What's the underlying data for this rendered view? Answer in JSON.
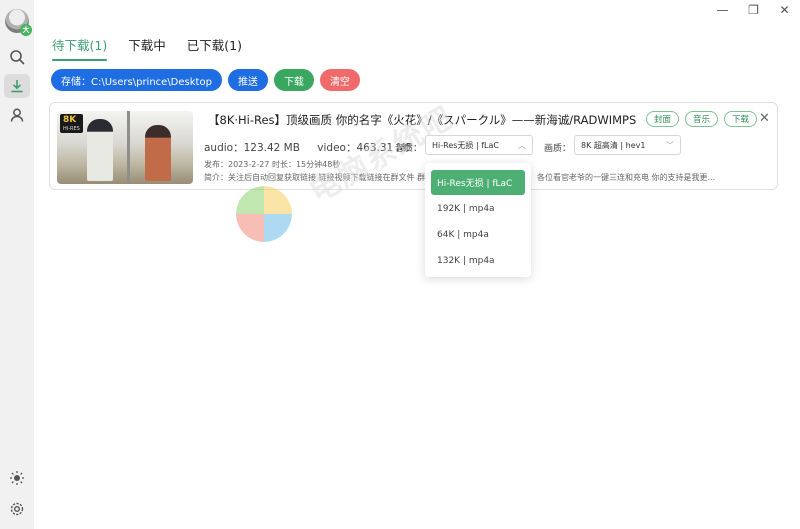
{
  "window_controls": {
    "minimize": "—",
    "restore": "❐",
    "close": "✕"
  },
  "sidebar": {
    "avatar_badge": "大",
    "items": [
      "search",
      "download",
      "user"
    ],
    "bottom": [
      "theme",
      "settings"
    ]
  },
  "tabs": [
    {
      "label": "待下载(1)",
      "active": true
    },
    {
      "label": "下载中",
      "active": false
    },
    {
      "label": "已下载(1)",
      "active": false
    }
  ],
  "toolbar": {
    "storage_label": "存储：C:\\Users\\prince\\Desktop",
    "push_label": "推送",
    "download_label": "下载",
    "clear_label": "清空"
  },
  "item": {
    "thumb_badge": "8K",
    "thumb_badge_sub": "HI-RES",
    "title": "【8K·Hi-Res】顶级画质 你的名字《火花》/《スパークル》——新海诚/RADWIMPS",
    "tags": [
      "封面",
      "音乐",
      "下载"
    ],
    "audio_size": "audio：123.42 MB",
    "video_size": "video：463.31 MB",
    "audio_quality_label": "音质：",
    "audio_quality_value": "Hi-Res无损 | fLaC",
    "video_quality_label": "画质：",
    "video_quality_value": "8K 超高清 | hev1",
    "publish": "发布：2023-2-27 时长：15分钟48秒",
    "intro_left": "简介：关注后自动回复获取链接 链接视频下载链接在群文件 群",
    "intro_right": "各位看官老爷的一键三连和充电 你的支持是我更..."
  },
  "audio_dropdown": {
    "options": [
      "Hi-Res无损 | fLaC",
      "192K | mp4a",
      "64K | mp4a",
      "132K | mp4a"
    ],
    "selected": "Hi-Res无损 | fLaC"
  },
  "watermark": {
    "text": "电脑系统吧",
    "url": "www.dnxtc.com"
  },
  "colors": {
    "accent_green": "#3e9e72",
    "blue": "#1e6de3",
    "green": "#3aa760",
    "red": "#ef6b6b"
  }
}
